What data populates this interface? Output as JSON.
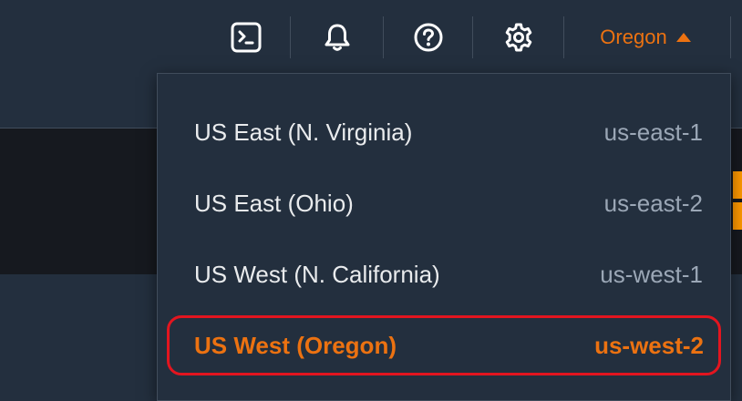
{
  "topbar": {
    "icons": [
      "terminal-icon",
      "bell-icon",
      "help-icon",
      "gear-icon"
    ],
    "region_label": "Oregon",
    "accent_color": "#ec7211"
  },
  "region_menu": {
    "options": [
      {
        "name": "US East (N. Virginia)",
        "code": "us-east-1",
        "selected": false
      },
      {
        "name": "US East (Ohio)",
        "code": "us-east-2",
        "selected": false
      },
      {
        "name": "US West (N. California)",
        "code": "us-west-1",
        "selected": false
      },
      {
        "name": "US West (Oregon)",
        "code": "us-west-2",
        "selected": true
      }
    ],
    "highlight_color": "#e3151f"
  }
}
